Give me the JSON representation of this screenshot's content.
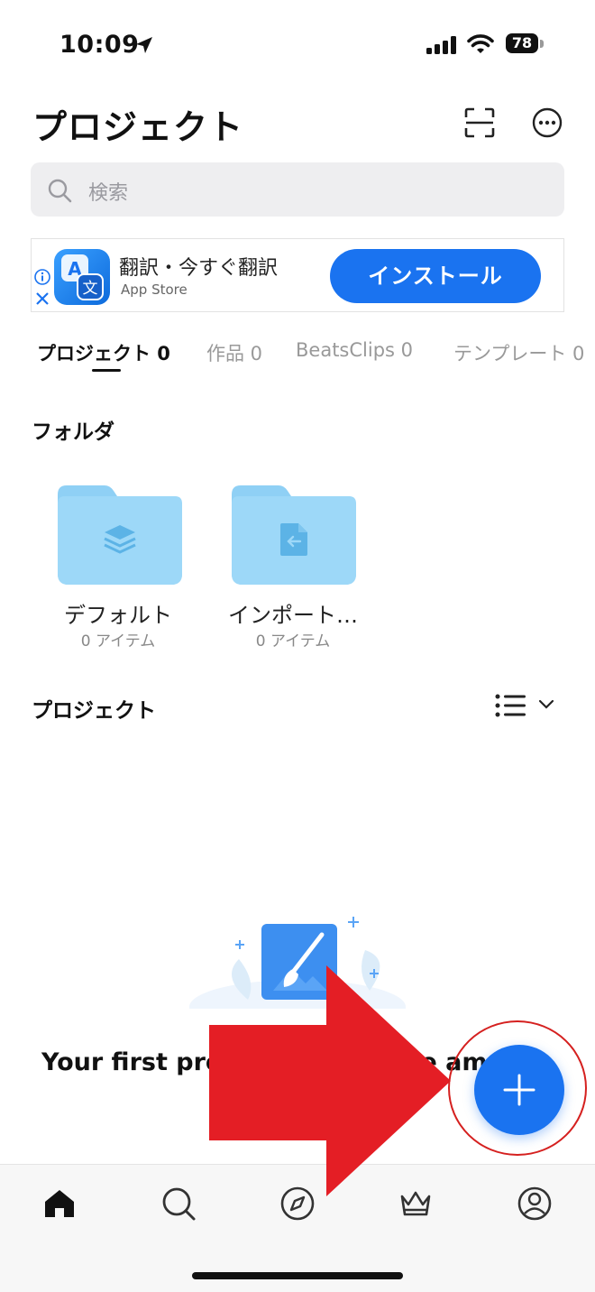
{
  "status_bar": {
    "time": "10:09",
    "battery": "78"
  },
  "header": {
    "title": "プロジェクト"
  },
  "search": {
    "placeholder": "検索"
  },
  "ad": {
    "app_name": "翻訳・今すぐ翻訳",
    "store": "App Store",
    "install_label": "インストール"
  },
  "tabs": [
    {
      "label": "プロジェクト 0",
      "active": true
    },
    {
      "label": "作品 0",
      "active": false
    },
    {
      "label": "BeatsClips 0",
      "active": false
    },
    {
      "label": "テンプレート 0",
      "active": false
    }
  ],
  "folders_section": {
    "title": "フォルダ"
  },
  "folders": [
    {
      "name": "デフォルト",
      "count": "0 アイテム",
      "icon": "layers-icon"
    },
    {
      "name": "インポート…",
      "count": "0 アイテム",
      "icon": "import-file-icon"
    }
  ],
  "projects_section": {
    "title": "プロジェクト"
  },
  "empty_state": {
    "text_left": "Your first pro",
    "text_right": "e am"
  },
  "bottom_nav": [
    {
      "name": "home-icon"
    },
    {
      "name": "search-icon"
    },
    {
      "name": "compass-icon"
    },
    {
      "name": "crown-icon"
    },
    {
      "name": "profile-icon"
    }
  ],
  "colors": {
    "accent": "#1a73f0",
    "annotation_red": "#e41e25",
    "folder": "#8fd0f5"
  }
}
